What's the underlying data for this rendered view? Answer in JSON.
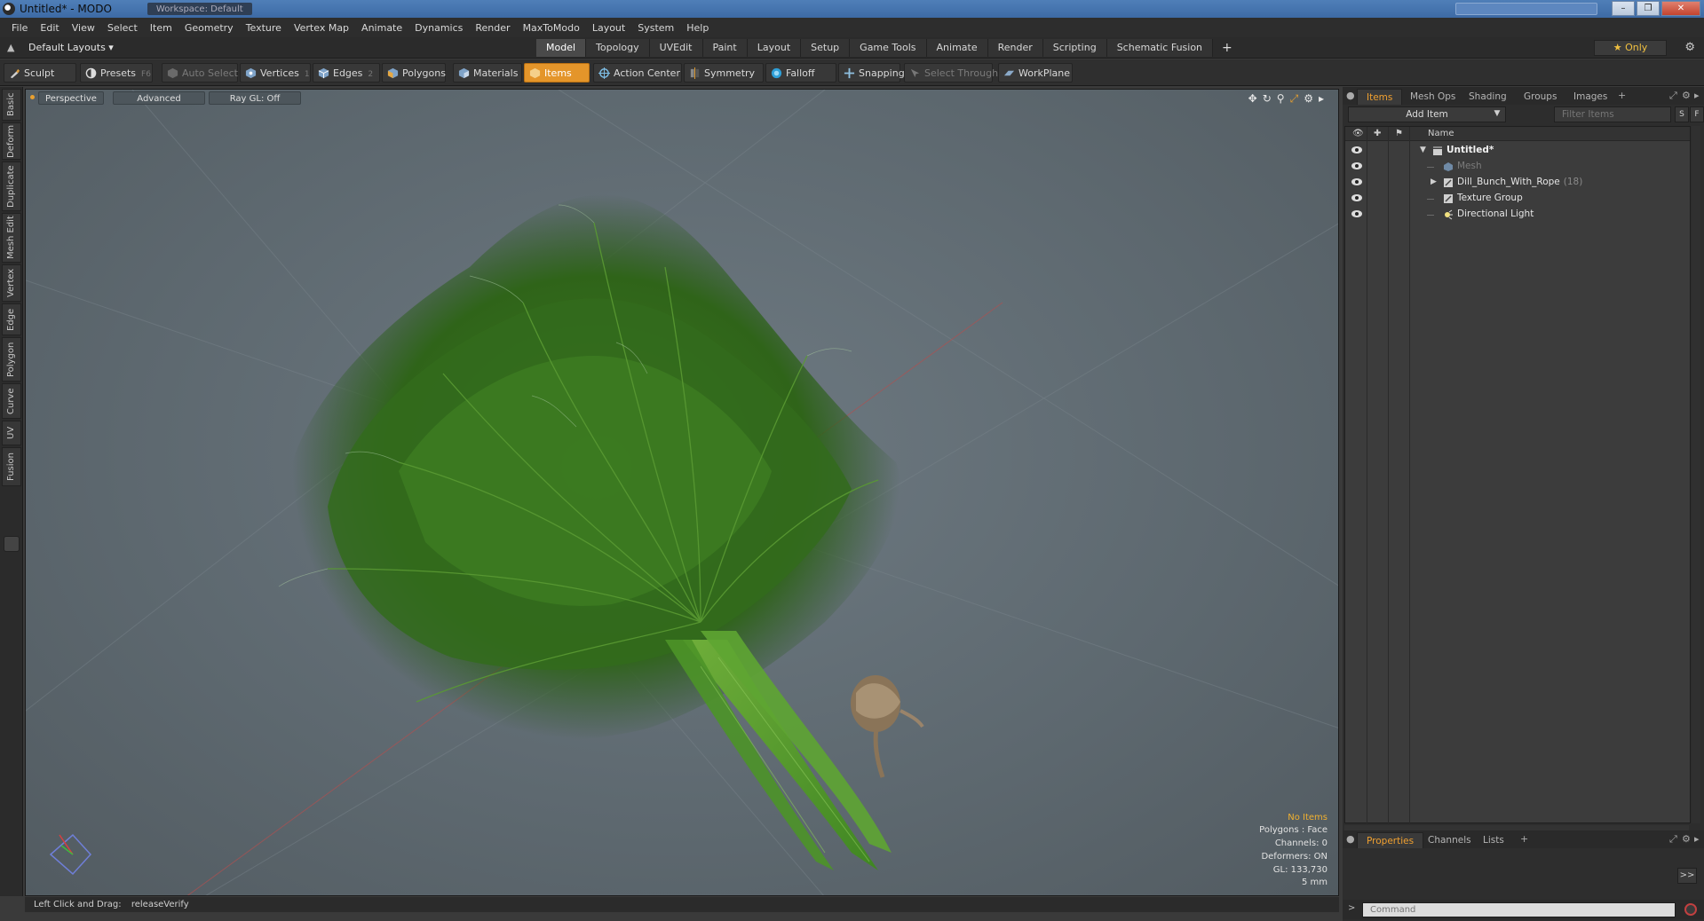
{
  "window": {
    "title": "Untitled* - MODO",
    "tab": "Workspace: Default",
    "controls": [
      "–",
      "❐",
      "✕"
    ]
  },
  "menu": [
    "File",
    "Edit",
    "View",
    "Select",
    "Item",
    "Geometry",
    "Texture",
    "Vertex Map",
    "Animate",
    "Dynamics",
    "Render",
    "MaxToModo",
    "Layout",
    "System",
    "Help"
  ],
  "layouts": {
    "dropdown": "Default Layouts ▾",
    "tabs": [
      "Model",
      "Topology",
      "UVEdit",
      "Paint",
      "Layout",
      "Setup",
      "Game Tools",
      "Animate",
      "Render",
      "Scripting",
      "Schematic Fusion"
    ],
    "active_tab": "Model",
    "plus": "+",
    "only_label": "★  Only"
  },
  "toolbar": {
    "sculpt": "Sculpt",
    "presets": "Presets",
    "presets_key": "F6",
    "auto_select": "Auto Select",
    "vertices": "Vertices",
    "vertices_key": "1",
    "edges": "Edges",
    "edges_key": "2",
    "polygons": "Polygons",
    "materials": "Materials",
    "items": "Items",
    "action_center": "Action Center",
    "symmetry": "Symmetry",
    "falloff": "Falloff",
    "snapping": "Snapping",
    "select_through": "Select Through",
    "workplane": "WorkPlane"
  },
  "left_tabs": [
    "Basic",
    "Deform",
    "Duplicate",
    "Mesh Edit",
    "Vertex",
    "Edge",
    "Polygon",
    "Curve",
    "UV",
    "Fusion"
  ],
  "viewport": {
    "view_mode": "Perspective",
    "shading": "Advanced",
    "raygl": "Ray GL: Off",
    "info": {
      "selection": "No Items",
      "polygons": "Polygons : Face",
      "channels": "Channels: 0",
      "deformers": "Deformers: ON",
      "gl": "GL: 133,730",
      "grid": "5 mm"
    }
  },
  "status": {
    "hint": "Left Click and Drag:",
    "value": "releaseVerify"
  },
  "right_panel": {
    "tabs": [
      "Items",
      "Mesh Ops",
      "Shading",
      "Groups",
      "Images"
    ],
    "active_tab": "Items",
    "add_item": "Add Item",
    "filter_placeholder": "Filter Items",
    "btn_s": "S",
    "btn_f": "F",
    "column_name": "Name",
    "items": [
      {
        "label": "Untitled*",
        "bold": true,
        "dim": false,
        "count": ""
      },
      {
        "label": "Mesh",
        "bold": false,
        "dim": true,
        "count": ""
      },
      {
        "label": "Dill_Bunch_With_Rope",
        "bold": false,
        "dim": false,
        "count": "(18)"
      },
      {
        "label": "Texture Group",
        "bold": false,
        "dim": false,
        "count": ""
      },
      {
        "label": "Directional Light",
        "bold": false,
        "dim": false,
        "count": ""
      }
    ],
    "bottom_tabs": [
      "Properties",
      "Channels",
      "Lists"
    ],
    "bottom_active": "Properties",
    "expand": ">>",
    "command_placeholder": "Command"
  }
}
